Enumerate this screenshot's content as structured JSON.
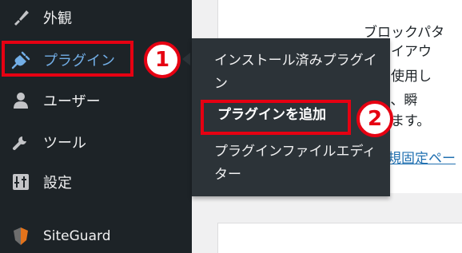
{
  "sidebar": {
    "items": [
      {
        "key": "appearance",
        "label": "外観",
        "icon": "paintbrush-icon"
      },
      {
        "key": "plugins",
        "label": "プラグイン",
        "icon": "plugin-icon"
      },
      {
        "key": "users",
        "label": "ユーザー",
        "icon": "user-icon"
      },
      {
        "key": "tools",
        "label": "ツール",
        "icon": "wrench-icon"
      },
      {
        "key": "settings",
        "label": "設定",
        "icon": "settings-icon"
      },
      {
        "key": "siteguard",
        "label": "SiteGuard",
        "icon": "siteguard-shield-icon"
      }
    ]
  },
  "submenu": {
    "items": [
      {
        "label": "インストール済みプラグイン"
      },
      {
        "label": "プラグインを追加"
      },
      {
        "label": "プラグインファイルエディター"
      }
    ]
  },
  "badges": {
    "step1": "1",
    "step2": "2"
  },
  "panel": {
    "lines": [
      "ブロックパタ",
      "アレイアウ",
      "ンを使用し",
      "たり、瞬",
      "できます。"
    ],
    "link": "規固定ペー"
  },
  "colors": {
    "sidebar_bg": "#1d2327",
    "submenu_bg": "#2c3338",
    "active_label": "#72aee6",
    "highlight": "#e60012",
    "link": "#2271b1"
  }
}
